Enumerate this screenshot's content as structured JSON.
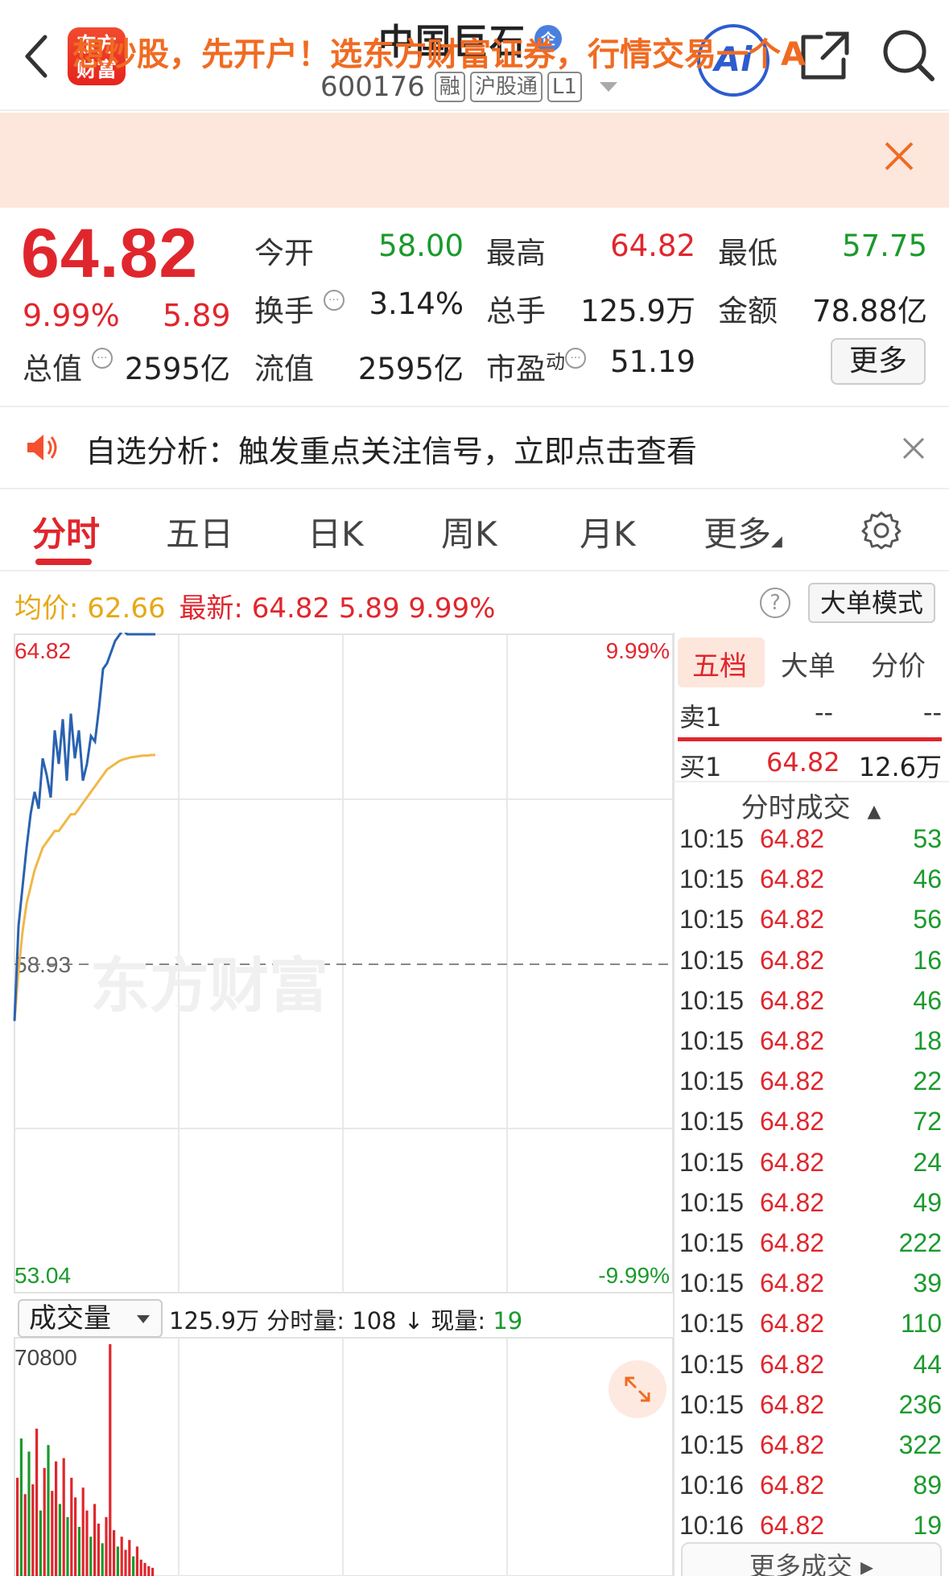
{
  "header": {
    "brand_line1": "东方",
    "brand_line2": "财富",
    "stock_name": "中国巨石",
    "ent_badge": "企",
    "stock_code": "600176",
    "tags": [
      "融",
      "沪股通",
      "L1"
    ],
    "ai_label": "Ai"
  },
  "promo": {
    "text": "想炒股，先开户！选东方财富证券，行情交易一个A"
  },
  "quote": {
    "price": "64.82",
    "change_pct": "9.99%",
    "change_abs": "5.89",
    "open_label": "今开",
    "open_value": "58.00",
    "high_label": "最高",
    "high_value": "64.82",
    "low_label": "最低",
    "low_value": "57.75",
    "turnover_label": "换手",
    "turnover_value": "3.14%",
    "volume_label": "总手",
    "volume_value": "125.9万",
    "amount_label": "金额",
    "amount_value": "78.88亿",
    "mktcap_label": "总值",
    "mktcap_value": "2595亿",
    "float_label": "流值",
    "float_value": "2595亿",
    "pe_label": "市盈",
    "pe_sup": "动",
    "pe_value": "51.19",
    "more_label": "更多"
  },
  "notice": {
    "text": "自选分析：触发重点关注信号，立即点击查看"
  },
  "tabs": [
    "分时",
    "五日",
    "日K",
    "周K",
    "月K",
    "更多"
  ],
  "summary": {
    "avg_label": "均价:",
    "avg_value": "62.66",
    "latest_label": "最新:",
    "latest_price": "64.82",
    "latest_change": "5.89",
    "latest_pct": "9.99%",
    "help_glyph": "?",
    "big_order_mode": "大单模式"
  },
  "colors": {
    "up": "#e0262d",
    "down": "#1a9a2c",
    "avg_line": "#f0b848",
    "price_line": "#2a62b0",
    "promo_bg": "#fde6dc"
  },
  "chart_data": {
    "type": "line",
    "price_axis_labels": {
      "top": "64.82",
      "mid": "58.93",
      "bottom": "53.04"
    },
    "pct_axis_labels": {
      "top": "9.99%",
      "bottom": "-9.99%"
    },
    "ylim": [
      53.04,
      64.82
    ],
    "prev_close": 58.93,
    "series": [
      {
        "values": [
          57.9,
          59.6,
          60.3,
          61.0,
          61.6,
          62.0,
          61.7,
          62.6,
          62.3,
          61.9,
          63.1,
          62.5,
          63.3,
          62.2,
          63.4,
          62.6,
          63.1,
          62.2,
          62.5,
          63.0,
          62.9,
          63.5,
          64.2,
          64.3,
          64.5,
          64.7,
          64.8,
          64.9,
          64.82,
          64.82,
          64.82,
          64.82,
          64.82,
          64.82,
          64.82,
          64.82
        ]
      },
      {
        "values": [
          57.9,
          58.8,
          59.5,
          60.0,
          60.3,
          60.6,
          60.8,
          61.0,
          61.1,
          61.2,
          61.3,
          61.3,
          61.4,
          61.5,
          61.6,
          61.6,
          61.7,
          61.8,
          61.9,
          62.0,
          62.1,
          62.2,
          62.3,
          62.4,
          62.45,
          62.5,
          62.55,
          62.58,
          62.6,
          62.62,
          62.63,
          62.64,
          62.65,
          62.65,
          62.66,
          62.66
        ]
      }
    ],
    "volume_max_label": "70800",
    "volume_ylim": [
      0,
      70800
    ],
    "volumes": [
      {
        "v": 30000,
        "up": true
      },
      {
        "v": 42000,
        "up": false
      },
      {
        "v": 25000,
        "up": true
      },
      {
        "v": 38000,
        "up": false
      },
      {
        "v": 28000,
        "up": true
      },
      {
        "v": 45000,
        "up": true
      },
      {
        "v": 20000,
        "up": false
      },
      {
        "v": 33000,
        "up": true
      },
      {
        "v": 40000,
        "up": false
      },
      {
        "v": 26000,
        "up": true
      },
      {
        "v": 35000,
        "up": true
      },
      {
        "v": 22000,
        "up": false
      },
      {
        "v": 36000,
        "up": true
      },
      {
        "v": 18000,
        "up": false
      },
      {
        "v": 30000,
        "up": true
      },
      {
        "v": 24000,
        "up": true
      },
      {
        "v": 15000,
        "up": false
      },
      {
        "v": 27000,
        "up": true
      },
      {
        "v": 20000,
        "up": true
      },
      {
        "v": 12000,
        "up": false
      },
      {
        "v": 22000,
        "up": true
      },
      {
        "v": 16000,
        "up": true
      },
      {
        "v": 10000,
        "up": false
      },
      {
        "v": 18000,
        "up": true
      },
      {
        "v": 70800,
        "up": true
      },
      {
        "v": 14000,
        "up": true
      },
      {
        "v": 9000,
        "up": false
      },
      {
        "v": 12000,
        "up": true
      },
      {
        "v": 8000,
        "up": true
      },
      {
        "v": 11000,
        "up": true
      },
      {
        "v": 6000,
        "up": false
      },
      {
        "v": 9000,
        "up": true
      },
      {
        "v": 5000,
        "up": true
      },
      {
        "v": 4000,
        "up": true
      },
      {
        "v": 3000,
        "up": true
      },
      {
        "v": 2500,
        "up": true
      }
    ],
    "watermark": "东方财富"
  },
  "volume_panel": {
    "selector": "成交量",
    "total": "125.9万",
    "minute_label": "分时量:",
    "minute_value": "108",
    "arrow": "↓",
    "current_label": "现量:",
    "current_value": "19"
  },
  "orderbook": {
    "tabs": [
      "五档",
      "大单",
      "分价"
    ],
    "sell1_label": "卖1",
    "sell1_price": "--",
    "sell1_vol": "--",
    "buy1_label": "买1",
    "buy1_price": "64.82",
    "buy1_vol": "12.6万",
    "trades_header": "分时成交",
    "trades_arrow": "▲",
    "trades": [
      {
        "time": "10:15",
        "price": "64.82",
        "vol": "53"
      },
      {
        "time": "10:15",
        "price": "64.82",
        "vol": "46"
      },
      {
        "time": "10:15",
        "price": "64.82",
        "vol": "56"
      },
      {
        "time": "10:15",
        "price": "64.82",
        "vol": "16"
      },
      {
        "time": "10:15",
        "price": "64.82",
        "vol": "46"
      },
      {
        "time": "10:15",
        "price": "64.82",
        "vol": "18"
      },
      {
        "time": "10:15",
        "price": "64.82",
        "vol": "22"
      },
      {
        "time": "10:15",
        "price": "64.82",
        "vol": "72"
      },
      {
        "time": "10:15",
        "price": "64.82",
        "vol": "24"
      },
      {
        "time": "10:15",
        "price": "64.82",
        "vol": "49"
      },
      {
        "time": "10:15",
        "price": "64.82",
        "vol": "222"
      },
      {
        "time": "10:15",
        "price": "64.82",
        "vol": "39"
      },
      {
        "time": "10:15",
        "price": "64.82",
        "vol": "110"
      },
      {
        "time": "10:15",
        "price": "64.82",
        "vol": "44"
      },
      {
        "time": "10:15",
        "price": "64.82",
        "vol": "236"
      },
      {
        "time": "10:15",
        "price": "64.82",
        "vol": "322"
      },
      {
        "time": "10:16",
        "price": "64.82",
        "vol": "89"
      },
      {
        "time": "10:16",
        "price": "64.82",
        "vol": "19"
      }
    ],
    "more_trades": "更多成交 ▸"
  }
}
